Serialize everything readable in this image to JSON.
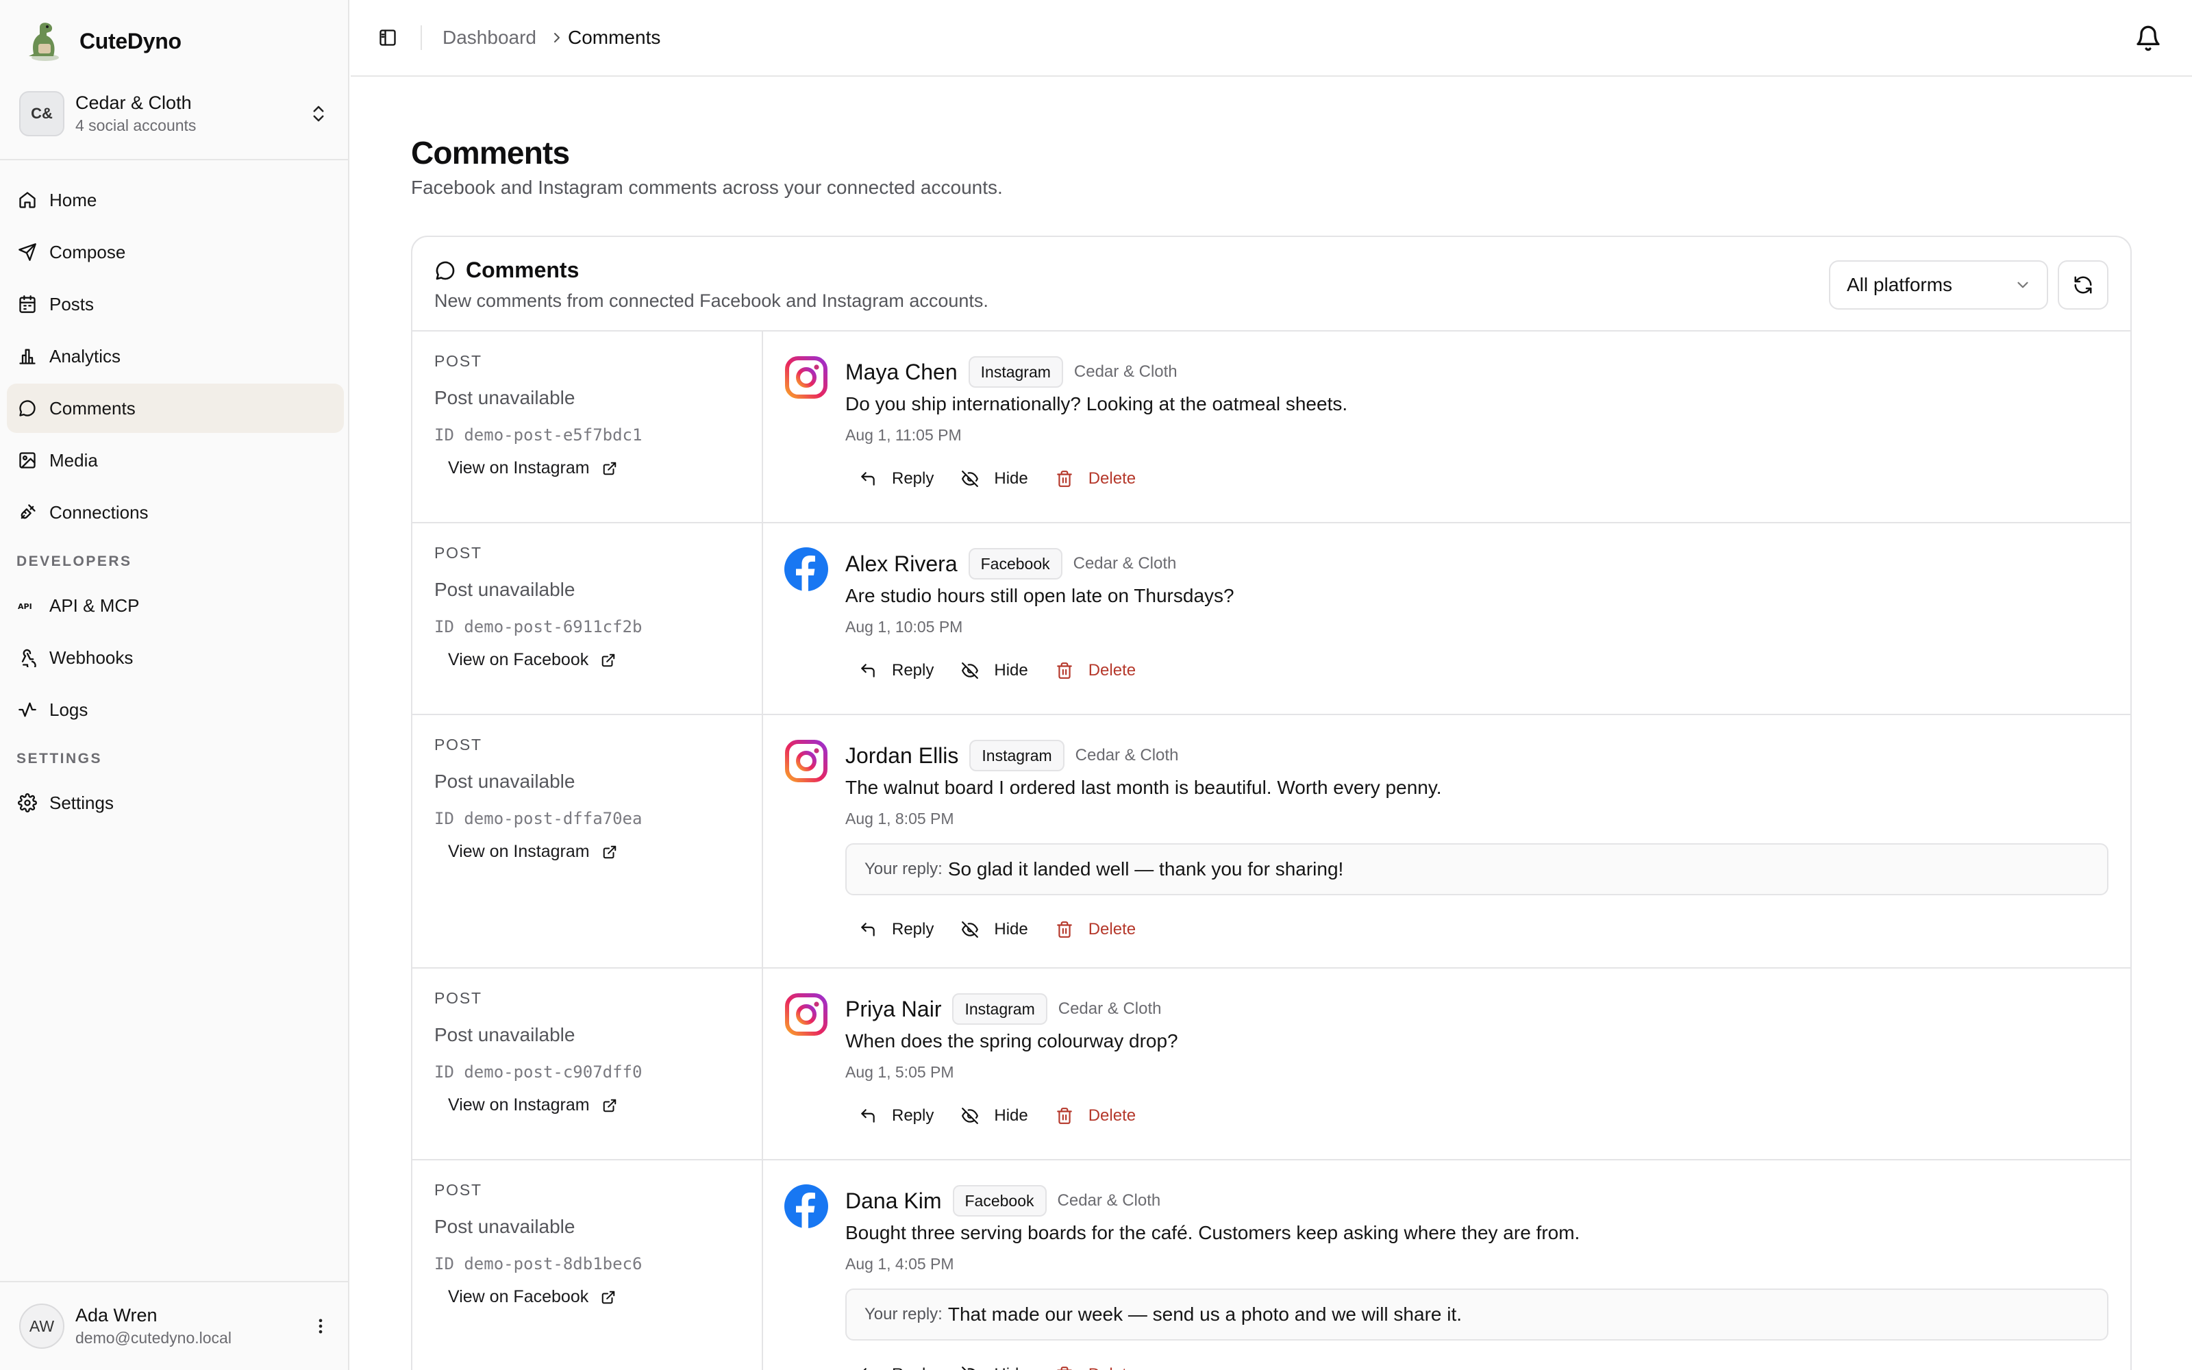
{
  "brand": {
    "name": "CuteDyno"
  },
  "account": {
    "initials": "C&",
    "name": "Cedar & Cloth",
    "sub": "4 social accounts"
  },
  "nav": {
    "home": "Home",
    "compose": "Compose",
    "posts": "Posts",
    "analytics": "Analytics",
    "comments": "Comments",
    "media": "Media",
    "connections": "Connections",
    "developers_section": "DEVELOPERS",
    "api": "API & MCP",
    "webhooks": "Webhooks",
    "logs": "Logs",
    "settings_section": "SETTINGS",
    "settings": "Settings"
  },
  "user": {
    "initials": "AW",
    "name": "Ada Wren",
    "email": "demo@cutedyno.local"
  },
  "breadcrumb": {
    "root": "Dashboard",
    "current": "Comments"
  },
  "page": {
    "title": "Comments",
    "subtitle": "Facebook and Instagram comments across your connected accounts."
  },
  "card": {
    "title": "Comments",
    "subtitle": "New comments from connected Facebook and Instagram accounts.",
    "filter_value": "All platforms"
  },
  "labels": {
    "post": "POST",
    "reply": "Reply",
    "hide": "Hide",
    "delete": "Delete",
    "your_reply": "Your reply:"
  },
  "comments": [
    {
      "post_status": "Post unavailable",
      "post_id": "ID demo-post-e5f7bdc1",
      "view_link": "View on Instagram",
      "platform": "Instagram",
      "author": "Maya Chen",
      "account": "Cedar & Cloth",
      "text": "Do you ship internationally? Looking at the oatmeal sheets.",
      "time": "Aug 1, 11:05 PM"
    },
    {
      "post_status": "Post unavailable",
      "post_id": "ID demo-post-6911cf2b",
      "view_link": "View on Facebook",
      "platform": "Facebook",
      "author": "Alex Rivera",
      "account": "Cedar & Cloth",
      "text": "Are studio hours still open late on Thursdays?",
      "time": "Aug 1, 10:05 PM"
    },
    {
      "post_status": "Post unavailable",
      "post_id": "ID demo-post-dffa70ea",
      "view_link": "View on Instagram",
      "platform": "Instagram",
      "author": "Jordan Ellis",
      "account": "Cedar & Cloth",
      "text": "The walnut board I ordered last month is beautiful. Worth every penny.",
      "time": "Aug 1, 8:05 PM",
      "reply": "So glad it landed well — thank you for sharing!"
    },
    {
      "post_status": "Post unavailable",
      "post_id": "ID demo-post-c907dff0",
      "view_link": "View on Instagram",
      "platform": "Instagram",
      "author": "Priya Nair",
      "account": "Cedar & Cloth",
      "text": "When does the spring colourway drop?",
      "time": "Aug 1, 5:05 PM"
    },
    {
      "post_status": "Post unavailable",
      "post_id": "ID demo-post-8db1bec6",
      "view_link": "View on Facebook",
      "platform": "Facebook",
      "author": "Dana Kim",
      "account": "Cedar & Cloth",
      "text": "Bought three serving boards for the café. Customers keep asking where they are from.",
      "time": "Aug 1, 4:05 PM",
      "reply": "That made our week — send us a photo and we will share it."
    }
  ]
}
